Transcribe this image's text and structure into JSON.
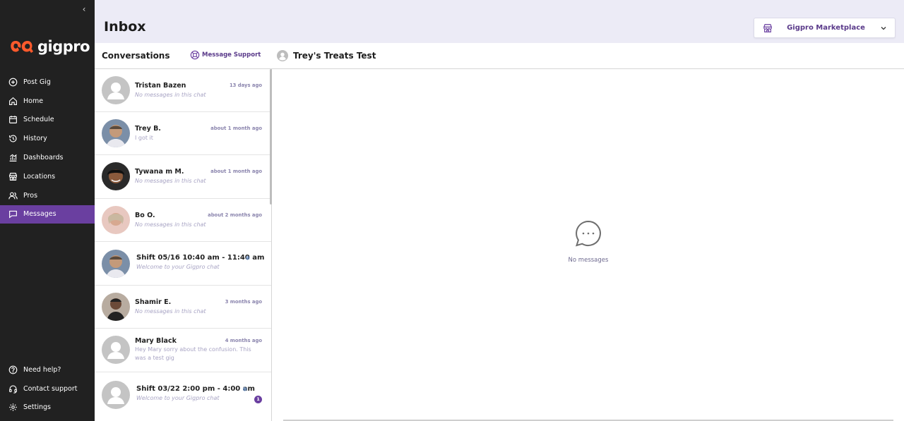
{
  "sidebar": {
    "collapse_glyph": "‹",
    "logo_text": "gigpro",
    "nav": [
      {
        "label": "Post Gig",
        "icon": "plus-circle-icon"
      },
      {
        "label": "Home",
        "icon": "home-icon"
      },
      {
        "label": "Schedule",
        "icon": "calendar-icon"
      },
      {
        "label": "History",
        "icon": "history-icon"
      },
      {
        "label": "Dashboards",
        "icon": "chart-icon"
      },
      {
        "label": "Locations",
        "icon": "store-icon"
      },
      {
        "label": "Pros",
        "icon": "users-icon"
      },
      {
        "label": "Messages",
        "icon": "message-icon",
        "active": true
      }
    ],
    "bottom": [
      {
        "label": "Need help?",
        "icon": "help-icon"
      },
      {
        "label": "Contact support",
        "icon": "headset-icon"
      },
      {
        "label": "Settings",
        "icon": "gear-icon"
      }
    ]
  },
  "header": {
    "title": "Inbox",
    "marketplace": "Gigpro Marketplace"
  },
  "conversations": {
    "title": "Conversations",
    "support_link": "Message Support",
    "items": [
      {
        "name": "Tristan Bazen",
        "time": "13 days ago",
        "preview": "No messages in this chat"
      },
      {
        "name": "Trey B.",
        "time": "about 1 month ago",
        "preview": "I got it"
      },
      {
        "name": "Tywana m M.",
        "time": "about 1 month ago",
        "preview": "No messages in this chat"
      },
      {
        "name": "Bo O.",
        "time": "about 2 months ago",
        "preview": "No messages in this chat"
      },
      {
        "name": "Shift 05/16 10:40 am - 11:40 am",
        "time": "",
        "preview": "Welcome to your Gigpro chat"
      },
      {
        "name": "Shamir E.",
        "time": "3 months ago",
        "preview": "No messages in this chat"
      },
      {
        "name": "Mary Black",
        "time": "4 months ago",
        "preview": "Hey Mary sorry about the confusion. This was a test gig"
      },
      {
        "name": "Shift 03/22 2:00 pm - 4:00 am",
        "time": "",
        "preview": "Welcome to your Gigpro chat",
        "badge": "1"
      }
    ]
  },
  "chat": {
    "title": "Trey's Treats Test",
    "empty_text": "No messages"
  },
  "colors": {
    "sidebar_bg": "#212121",
    "accent": "#6a3fa0",
    "header_bg": "#ecebf6",
    "logo_orange": "#ff5a2c"
  }
}
